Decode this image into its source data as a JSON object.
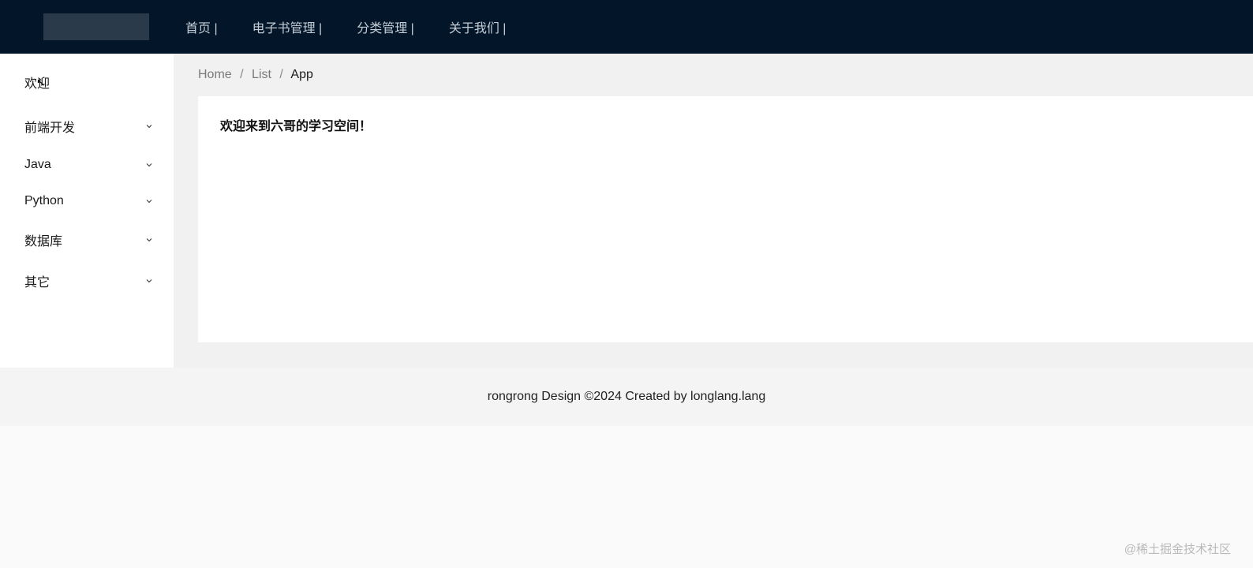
{
  "nav": {
    "items": [
      {
        "label": "首页 |"
      },
      {
        "label": "电子书管理 |"
      },
      {
        "label": "分类管理 |"
      },
      {
        "label": "关于我们 |"
      }
    ]
  },
  "sidebar": {
    "items": [
      {
        "label": "欢迎",
        "expandable": false
      },
      {
        "label": "前端开发",
        "expandable": true
      },
      {
        "label": "Java",
        "expandable": true
      },
      {
        "label": "Python",
        "expandable": true
      },
      {
        "label": "数据库",
        "expandable": true
      },
      {
        "label": "其它",
        "expandable": true
      }
    ]
  },
  "breadcrumb": {
    "home": "Home",
    "list": "List",
    "current": "App"
  },
  "main": {
    "welcome": "欢迎来到六哥的学习空间！"
  },
  "footer": {
    "text": "rongrong Design ©2024 Created by longlang.lang"
  },
  "watermark": "@稀土掘金技术社区"
}
